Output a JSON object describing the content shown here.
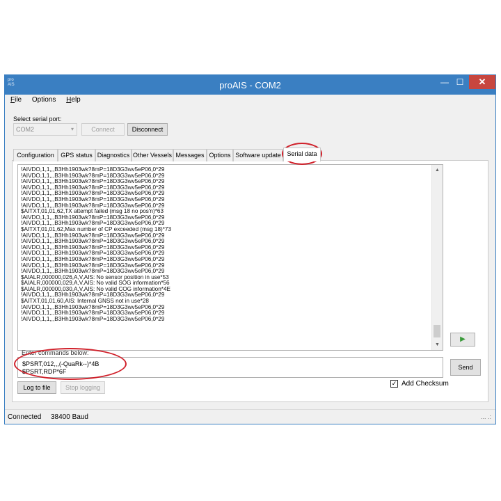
{
  "window": {
    "logo_line1": "pro",
    "logo_line2": "AIS",
    "title": "proAIS - COM2",
    "minimize_glyph": "—",
    "maximize_glyph": "☐",
    "close_glyph": "✕"
  },
  "menu": [
    {
      "key": "F",
      "rest": "ile"
    },
    {
      "key": "",
      "rest": "Options"
    },
    {
      "key": "H",
      "rest": "elp"
    }
  ],
  "serial": {
    "label": "Select serial port:",
    "port": "COM2",
    "connect_label": "Connect",
    "disconnect_label": "Disconnect"
  },
  "tabs": [
    "Configuration",
    "GPS status",
    "Diagnostics",
    "Other Vessels",
    "Messages",
    "Options",
    "Software update",
    "Serial data"
  ],
  "active_tab": "Serial data",
  "log_lines": [
    "!AIVDO,1,1,,,B3Hh1903wk?8mP=18D3G3wv5eP06,0*29",
    "!AIVDO,1,1,,,B3Hh1903wk?8mP=18D3G3wv5eP06,0*29",
    "!AIVDO,1,1,,,B3Hh1903wk?8mP=18D3G3wv5eP06,0*29",
    "!AIVDO,1,1,,,B3Hh1903wk?8mP=18D3G3wv5eP06,0*29",
    "!AIVDO,1,1,,,B3Hh1903wk?8mP=18D3G3wv5eP06,0*29",
    "!AIVDO,1,1,,,B3Hh1903wk?8mP=18D3G3wv5eP06,0*29",
    "!AIVDO,1,1,,,B3Hh1903wk?8mP=18D3G3wv5eP06,0*29",
    "$AITXT,01,01,62,TX attempt failed (msg 18 no pos'n)*63",
    "!AIVDO,1,1,,,B3Hh1903wk?8mP=18D3G3wv5eP06,0*29",
    "!AIVDO,1,1,,,B3Hh1903wk?8mP=18D3G3wv5eP06,0*29",
    "$AITXT,01,01,62,Max number of CP exceeded (msg 18)*73",
    "!AIVDO,1,1,,,B3Hh1903wk?8mP=18D3G3wv5eP06,0*29",
    "!AIVDO,1,1,,,B3Hh1903wk?8mP=18D3G3wv5eP06,0*29",
    "!AIVDO,1,1,,,B3Hh1903wk?8mP=18D3G3wv5eP06,0*29",
    "!AIVDO,1,1,,,B3Hh1903wk?8mP=18D3G3wv5eP06,0*29",
    "!AIVDO,1,1,,,B3Hh1903wk?8mP=18D3G3wv5eP06,0*29",
    "!AIVDO,1,1,,,B3Hh1903wk?8mP=18D3G3wv5eP06,0*29",
    "!AIVDO,1,1,,,B3Hh1903wk?8mP=18D3G3wv5eP06,0*29",
    "$AIALR,000000,026,A,V,AIS: No sensor position in use*53",
    "$AIALR,000000,029,A,V,AIS: No valid SOG information*56",
    "$AIALR,000000,030,A,V,AIS: No valid COG information*4E",
    "!AIVDO,1,1,,,B3Hh1903wk?8mP=18D3G3wv5eP06,0*29",
    "$AITXT,01,01,60,AIS: Internal GNSS not in use*28",
    "!AIVDO,1,1,,,B3Hh1903wk?8mP=18D3G3wv5eP06,0*29",
    "!AIVDO,1,1,,,B3Hh1903wk?8mP=18D3G3wv5eP06,0*29",
    "!AIVDO,1,1,,,B3Hh1903wk?8mP=18D3G3wv5eP06,0*29"
  ],
  "commands": {
    "label": "Enter commands below:",
    "lines": [
      "$PSRT,012,,,(-QuaRk--)*4B",
      "$PSRT,RDP*6F"
    ],
    "send_label": "Send",
    "play_glyph": "▶"
  },
  "logging": {
    "log_to_file_label": "Log to file",
    "stop_logging_label": "Stop logging"
  },
  "checksum": {
    "label": "Add Checksum",
    "checked": true,
    "check_glyph": "✓"
  },
  "status": {
    "state": "Connected",
    "baud": "38400 Baud",
    "grip": "... .:"
  },
  "scroll": {
    "up_glyph": "▲",
    "down_glyph": "▼"
  },
  "colors": {
    "titlebar": "#3a7fc2",
    "close": "#c7463f",
    "annotation": "#d0202a",
    "play": "#3a9a3a"
  }
}
